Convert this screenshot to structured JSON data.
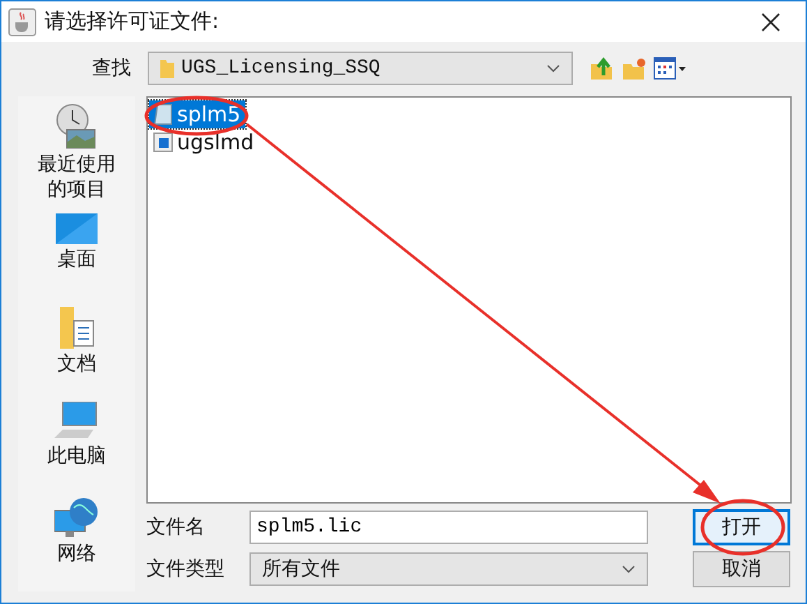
{
  "window": {
    "title": "请选择许可证文件:"
  },
  "look_in": {
    "label": "查找",
    "value": "UGS_Licensing_SSQ"
  },
  "places": [
    {
      "label": "最近使用的项目",
      "kind": "recent"
    },
    {
      "label": "桌面",
      "kind": "desktop"
    },
    {
      "label": "文档",
      "kind": "documents"
    },
    {
      "label": "此电脑",
      "kind": "computer"
    },
    {
      "label": "网络",
      "kind": "network"
    }
  ],
  "files": [
    {
      "name": "splm5",
      "kind": "license",
      "selected": true
    },
    {
      "name": "ugslmd",
      "kind": "program",
      "selected": false
    }
  ],
  "file_name": {
    "label": "文件名",
    "value": "splm5.lic"
  },
  "file_type": {
    "label": "文件类型",
    "value": "所有文件"
  },
  "buttons": [
    {
      "label": "打开",
      "focused": true
    },
    {
      "label": "取消",
      "focused": false
    }
  ]
}
